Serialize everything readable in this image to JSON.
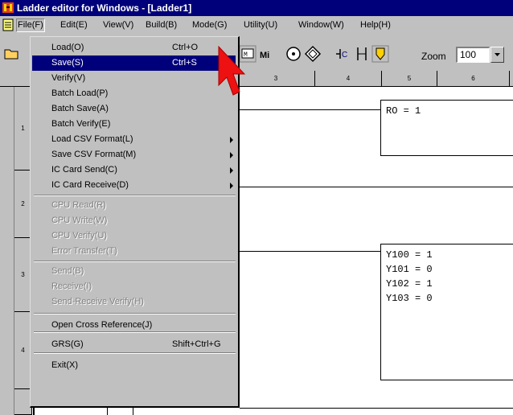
{
  "window": {
    "title": "Ladder editor for Windows - [Ladder1]"
  },
  "menubar": [
    {
      "label": "File(F)"
    },
    {
      "label": "Edit(E)"
    },
    {
      "label": "View(V)"
    },
    {
      "label": "Build(B)"
    },
    {
      "label": "Mode(G)"
    },
    {
      "label": "Utility(U)"
    },
    {
      "label": "Window(W)"
    },
    {
      "label": "Help(H)"
    }
  ],
  "toolbar": {
    "zoom_label": "Zoom",
    "zoom_value": "100"
  },
  "ruler": [
    "3",
    "4",
    "5",
    "6"
  ],
  "rows": [
    "1",
    "2",
    "3",
    "4"
  ],
  "boxes": {
    "box1": "RO = 1",
    "box2": "Y100 = 1\nY101 = 0\nY102 = 1\nY103 = 0"
  },
  "file_menu": {
    "items": [
      {
        "label": "Load(O)",
        "shortcut": "Ctrl+O"
      },
      {
        "label": "Save(S)",
        "shortcut": "Ctrl+S",
        "selected": true
      },
      {
        "label": "Verify(V)"
      },
      {
        "label": "Batch Load(P)"
      },
      {
        "label": "Batch Save(A)"
      },
      {
        "label": "Batch Verify(E)"
      },
      {
        "label": "Load CSV Format(L)",
        "submenu": true
      },
      {
        "label": "Save CSV Format(M)",
        "submenu": true
      },
      {
        "label": "IC Card Send(C)",
        "submenu": true
      },
      {
        "label": "IC Card Receive(D)",
        "submenu": true
      },
      {
        "label": "CPU Read(R)",
        "disabled": true
      },
      {
        "label": "CPU Write(W)",
        "disabled": true
      },
      {
        "label": "CPU Verify(U)",
        "disabled": true
      },
      {
        "label": "Error Transfer(T)",
        "disabled": true
      },
      {
        "label": "Send(B)",
        "disabled": true
      },
      {
        "label": "Receive(I)",
        "disabled": true
      },
      {
        "label": "Send-Receive Verify(H)",
        "disabled": true
      },
      {
        "label": "Open Cross Reference(J)"
      },
      {
        "label": "GRS(G)",
        "shortcut": "Shift+Ctrl+G"
      },
      {
        "label": "Exit(X)"
      }
    ]
  }
}
